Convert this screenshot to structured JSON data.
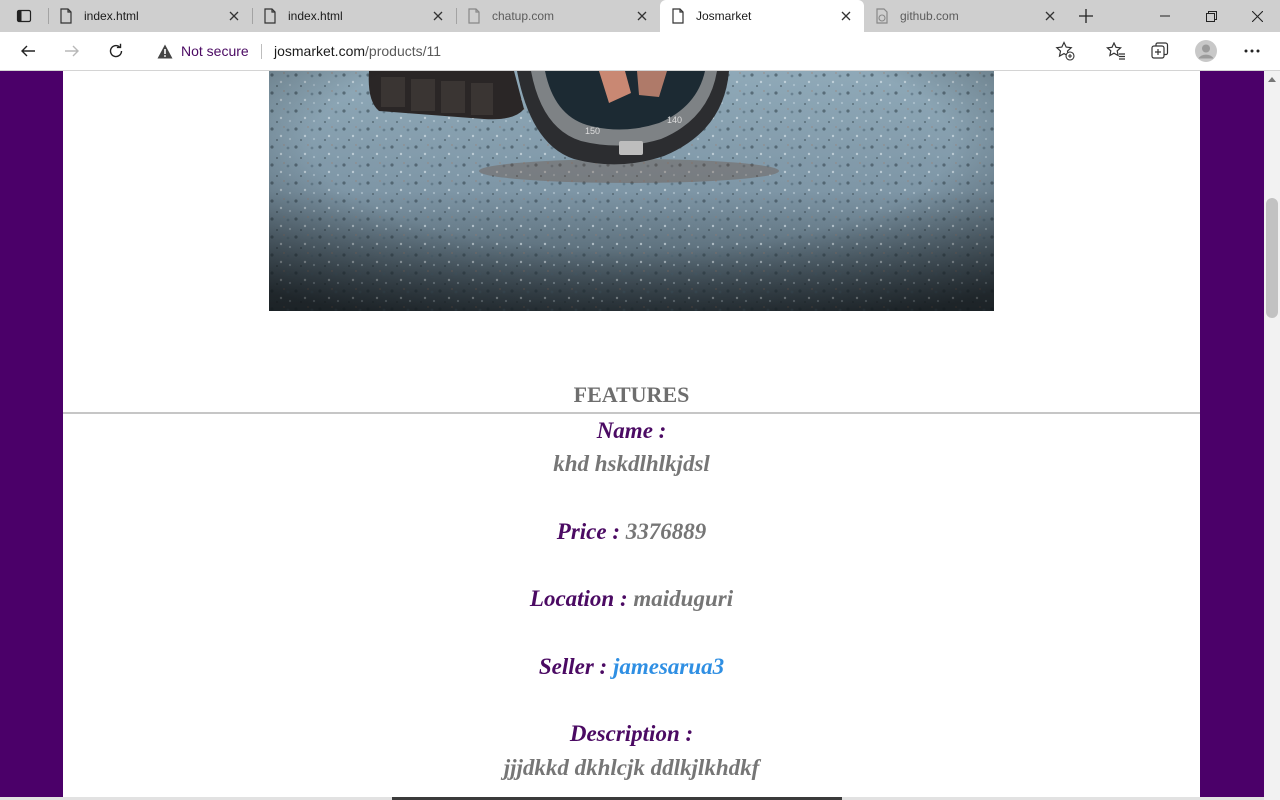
{
  "browser": {
    "tabs": [
      {
        "title": "index.html",
        "icon": "page-icon",
        "active": false
      },
      {
        "title": "index.html",
        "icon": "page-icon",
        "active": false
      },
      {
        "title": "chatup.com",
        "icon": "page-icon",
        "active": false
      },
      {
        "title": "Josmarket",
        "icon": "page-icon",
        "active": true
      },
      {
        "title": "github.com",
        "icon": "offline-page-icon",
        "active": false
      }
    ],
    "security_label": "Not secure",
    "url_host": "josmarket.com",
    "url_path": "/products/11"
  },
  "colors": {
    "page_background": "#4b0069",
    "label_color": "#4b0a63",
    "value_color": "#767676",
    "link_color": "#2f8fe3"
  },
  "product": {
    "image_icon": "wristwatch-photo",
    "features_heading": "FEATURES",
    "name_label": "Name :",
    "name_value": "khd hskdlhlkjdsl",
    "price_label": "Price :",
    "price_value": "3376889",
    "location_label": "Location :",
    "location_value": "maiduguri",
    "seller_label": "Seller :",
    "seller_value": "jamesarua3",
    "description_label": "Description :",
    "description_value": "jjjdkkd dkhlcjk ddlkjlkhdkf"
  }
}
